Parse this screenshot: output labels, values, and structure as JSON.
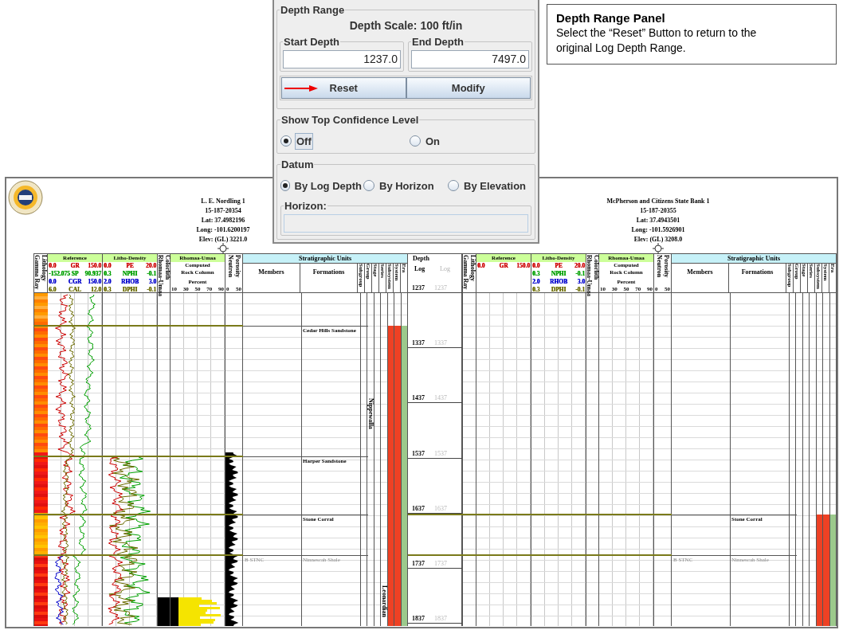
{
  "depth_range": {
    "title": "Depth Range",
    "scale": "Depth Scale: 100 ft/in",
    "fields": [
      {
        "label": "Start Depth",
        "value": "1237.0"
      },
      {
        "label": "End Depth",
        "value": "7497.0"
      }
    ],
    "buttons": [
      {
        "label": "Reset",
        "pointer": true
      },
      {
        "label": "Modify",
        "pointer": false
      }
    ]
  },
  "top_confidence": {
    "title": "Show Top Confidence Level",
    "options": [
      {
        "label": "Off",
        "selected": true,
        "focused": true
      },
      {
        "label": "On",
        "selected": false,
        "focused": false
      }
    ]
  },
  "datum": {
    "title": "Datum",
    "options": [
      {
        "label": "By Log Depth",
        "selected": true
      },
      {
        "label": "By Horizon",
        "selected": false
      },
      {
        "label": "By Elevation",
        "selected": false
      }
    ],
    "horizon": {
      "label": "Horizon:"
    }
  },
  "callout": {
    "title": "Depth Range Panel",
    "text": "Select the “Reset” Button to return to the original Log Depth Range."
  },
  "wells": [
    {
      "header": [
        "L. E. Nordling 1",
        "15-187-20354",
        "Lat: 37.4982196",
        "Long: -101.6200197",
        "Elev: (GL) 3221.0"
      ],
      "curves_loaded": true,
      "lithology": [
        "Lithology",
        "Gamma Ray"
      ],
      "reference": {
        "title": "Reference",
        "curves": [
          {
            "min": "0.0",
            "name": "GR",
            "max": "150.0",
            "color": "#cc0000"
          },
          {
            "min": "-152.075",
            "name": "SP",
            "max": "90.937",
            "color": "#00a000"
          },
          {
            "min": "0.0",
            "name": "CGR",
            "max": "150.0",
            "color": "#0000cc"
          },
          {
            "min": "6.0",
            "name": "CAL",
            "max": "12.0",
            "color": "#6b6b00"
          }
        ]
      },
      "litho_density": {
        "title": "Litho-Density",
        "curves": [
          {
            "min": "0.0",
            "name": "PE",
            "max": "20.0",
            "color": "#cc0000"
          },
          {
            "min": "0.3",
            "name": "NPHI",
            "max": "-0.1",
            "color": "#00a000"
          },
          {
            "min": "2.0",
            "name": "RHOB",
            "max": "3.0",
            "color": "#0000cc"
          },
          {
            "min": "0.3",
            "name": "DPHI",
            "max": "-0.1",
            "color": "#6b6b00"
          }
        ]
      },
      "colorlith": [
        "Colorlith",
        "Rhomaa-Umaa"
      ],
      "rhomaa": {
        "title": "Rhomaa-Umaa",
        "lines": [
          "Computed",
          "Rock Column",
          "Percent"
        ],
        "scale": [
          "10",
          "30",
          "50",
          "70",
          "90"
        ]
      },
      "porosity": {
        "title": [
          "Porosity",
          "Neutron"
        ],
        "scale": [
          "0",
          "50"
        ]
      },
      "strat": {
        "title": "Stratigraphic Units",
        "members": "Members",
        "formations": "Formations",
        "columns": [
          {
            "label": "Subgroup"
          },
          {
            "label": "Group",
            "entries": [
              "Nippewalla"
            ]
          },
          {
            "label": "Stage"
          },
          {
            "label": "Series",
            "entries": [
              "Leonardian"
            ]
          },
          {
            "label": "Subsystem",
            "color": "#ee4124"
          },
          {
            "label": "System",
            "color": "#ee4124"
          },
          {
            "label": "Era",
            "color": "#9cc98c"
          }
        ]
      },
      "tops": [
        {
          "formation": "Cedar Hills Sandstone",
          "muted": false
        },
        {
          "formation": "Harper Sandstone",
          "muted": false
        },
        {
          "formation": "Stone Corral",
          "muted": false
        },
        {
          "member": "B STNC",
          "formation": "Ninnescah Shale",
          "muted": true
        }
      ]
    },
    {
      "header": [
        "McPherson and Citizens State Bank 1",
        "15-187-20355",
        "Lat: 37.4943501",
        "Long: -101.5926901",
        "Elev: (GL) 3208.0"
      ],
      "curves_loaded": false,
      "lithology": [
        "Lithology",
        "Gamma Ray"
      ],
      "reference": {
        "title": "Reference",
        "curves": [
          {
            "min": "0.0",
            "name": "GR",
            "max": "150.0",
            "color": "#cc0000"
          }
        ]
      },
      "litho_density": {
        "title": "Litho-Density",
        "curves": [
          {
            "min": "0.0",
            "name": "PE",
            "max": "20.0",
            "color": "#cc0000"
          },
          {
            "min": "0.3",
            "name": "NPHI",
            "max": "-0.1",
            "color": "#00a000"
          },
          {
            "min": "2.0",
            "name": "RHOB",
            "max": "3.0",
            "color": "#0000cc"
          },
          {
            "min": "0.3",
            "name": "DPHI",
            "max": "-0.1",
            "color": "#6b6b00"
          }
        ]
      },
      "colorlith": [
        "Colorlith",
        "Rhomaa-Umaa"
      ],
      "rhomaa": {
        "title": "Rhomaa-Umaa",
        "lines": [
          "Computed",
          "Rock Column",
          "Percent"
        ],
        "scale": [
          "10",
          "30",
          "50",
          "70",
          "90"
        ]
      },
      "porosity": {
        "title": [
          "Porosity",
          "Neutron"
        ],
        "scale": [
          "0",
          "50"
        ]
      },
      "strat": {
        "title": "Stratigraphic Units",
        "members": "Members",
        "formations": "Formations",
        "columns": [
          {
            "label": "Subgroup"
          },
          {
            "label": "Group"
          },
          {
            "label": "Stage"
          },
          {
            "label": "Series"
          },
          {
            "label": "Subsystem",
            "color": "#ee4124"
          },
          {
            "label": "System",
            "color": "#ee4124"
          },
          {
            "label": "Era",
            "color": "#9cc98c"
          }
        ]
      },
      "tops": [
        {
          "formation": "Stone Corral",
          "muted": false
        },
        {
          "member": "B STNC",
          "formation": "Ninnescah Shale",
          "muted": true
        }
      ]
    }
  ],
  "depth_track": {
    "title": "Depth",
    "columns": [
      "Log",
      "Log"
    ],
    "ticks": [
      [
        "1237",
        "1237"
      ],
      [
        "1337",
        "1337"
      ],
      [
        "1437",
        "1437"
      ],
      [
        "1537",
        "1537"
      ],
      [
        "1637",
        "1637"
      ],
      [
        "1737",
        "1737"
      ],
      [
        "1837",
        "1837"
      ]
    ]
  }
}
